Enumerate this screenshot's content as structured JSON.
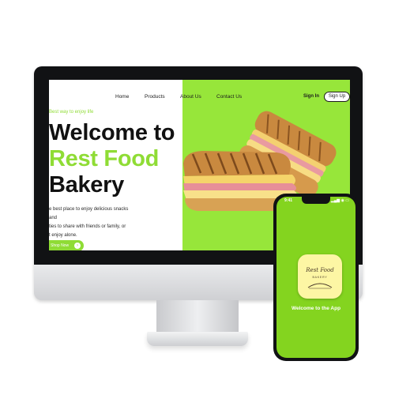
{
  "website": {
    "nav": [
      "Home",
      "Products",
      "About Us",
      "Contact Us"
    ],
    "sign_in": "Sign In",
    "sign_up": "Sign Up",
    "tagline": "Best way to enjoy life",
    "headline": {
      "line1": "Welcome to",
      "line2": "Rest Food",
      "line3": "Bakery"
    },
    "description": [
      "e best place to enjoy delicious snacks and",
      "ties to share with friends or family, or",
      "t enjoy alone."
    ],
    "cta_label": "Shop Now"
  },
  "phone": {
    "status_time": "9:41",
    "status_icons": "▂▄▆ ◉ ▭",
    "app_logo_text": "Rest Food",
    "app_logo_sub": "BAKERY",
    "app_title": "Welcome to the App"
  },
  "colors": {
    "brand_green": "#8fdc35",
    "hero_green": "#97e63a",
    "phone_green": "#84d41f",
    "app_icon_yellow": "#fdf6a4"
  }
}
